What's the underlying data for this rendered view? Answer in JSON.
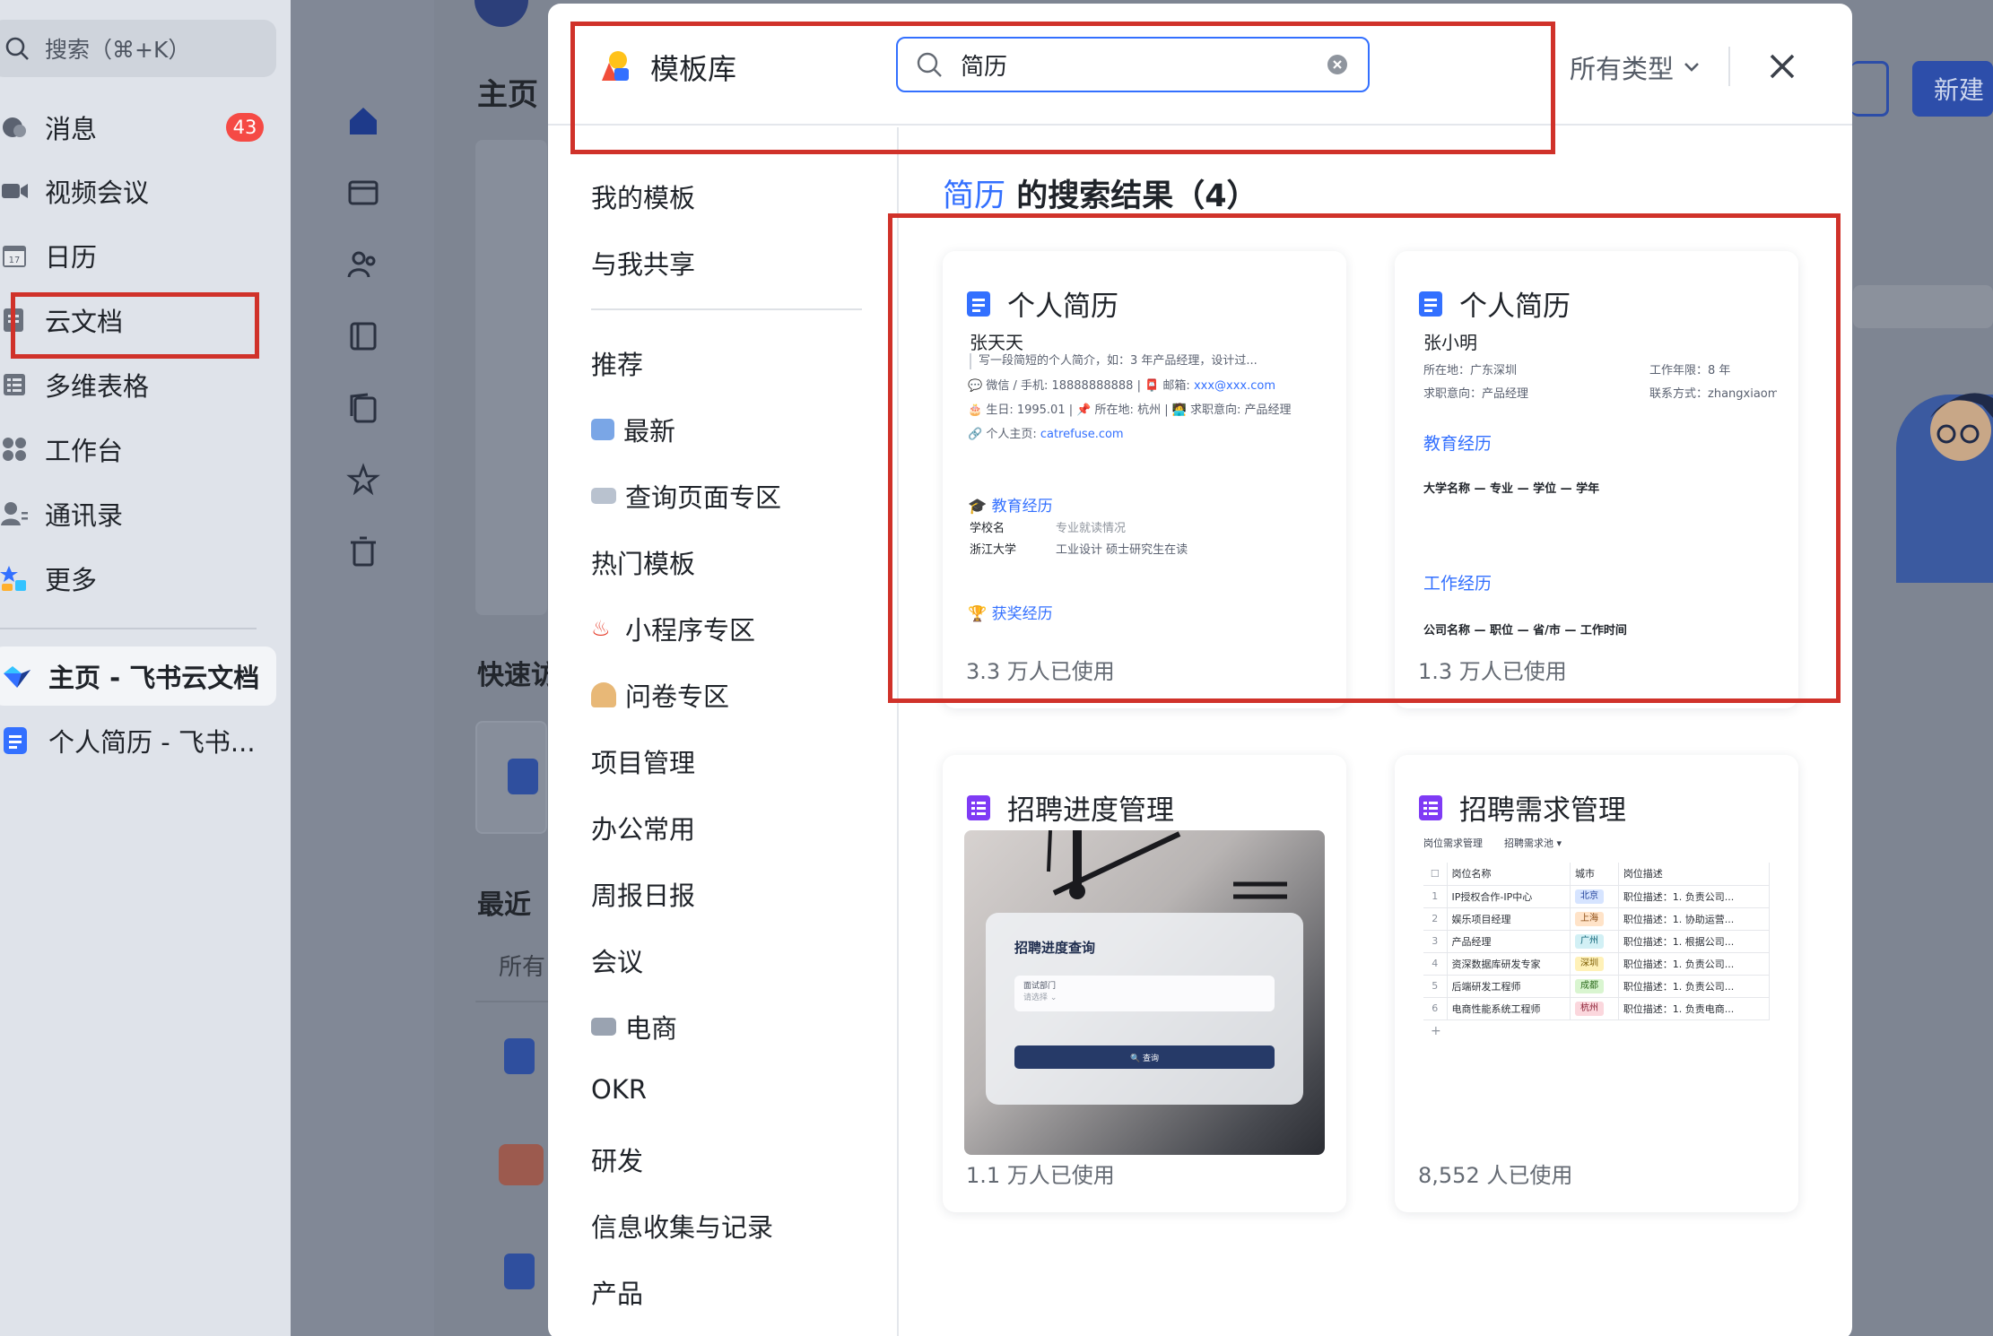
{
  "sidebar": {
    "search_placeholder": "搜索（⌘+K）",
    "nav_items": [
      {
        "label": "消息",
        "badge": "43",
        "icon": "message-icon"
      },
      {
        "label": "视频会议",
        "icon": "video-icon"
      },
      {
        "label": "日历",
        "icon": "calendar-icon"
      },
      {
        "label": "云文档",
        "icon": "doc-icon"
      },
      {
        "label": "多维表格",
        "icon": "table-icon"
      },
      {
        "label": "工作台",
        "icon": "apps-icon"
      },
      {
        "label": "通讯录",
        "icon": "contacts-icon"
      },
      {
        "label": "更多",
        "icon": "more-icon"
      }
    ],
    "recent": [
      {
        "label": "主页 - 飞书云文档"
      },
      {
        "label": "个人简历 - 飞书..."
      }
    ]
  },
  "background": {
    "home_title": "主页",
    "quick_title": "快速访",
    "recent_title": "最近",
    "all_filter": "所有",
    "new_button": "新建"
  },
  "modal": {
    "title": "模板库",
    "search_value": "简历",
    "type_filter": "所有类型",
    "categories": [
      {
        "label": "我的模板"
      },
      {
        "label": "与我共享"
      },
      {
        "label": "推荐"
      },
      {
        "label": "最新",
        "icon": "new-badge-icon"
      },
      {
        "label": "查询页面专区",
        "icon": "book-icon"
      },
      {
        "label": "热门模板"
      },
      {
        "label": "小程序专区",
        "icon": "hot-spring-icon"
      },
      {
        "label": "问卷专区",
        "icon": "person-icon"
      },
      {
        "label": "项目管理"
      },
      {
        "label": "办公常用"
      },
      {
        "label": "周报日报"
      },
      {
        "label": "会议"
      },
      {
        "label": "电商",
        "icon": "cart-icon"
      },
      {
        "label": "OKR"
      },
      {
        "label": "研发"
      },
      {
        "label": "信息收集与记录"
      },
      {
        "label": "产品"
      }
    ],
    "results": {
      "keyword": "简历",
      "suffix": "的搜索结果（4）"
    },
    "cards": [
      {
        "title": "个人简历",
        "usage": "3.3 万人已使用",
        "preview": {
          "name": "张天天",
          "intro": "写一段简短的个人简介，如：3 年产品经理，设计过...",
          "line1_a": "💬 微信 / 手机: 18888888888 | 📮 邮箱: ",
          "line1_email": "xxx@xxx.com",
          "line2": "🎂 生日: 1995.01 | 📌 所在地: 杭州 | 🧑‍💻 求职意向: 产品经理",
          "line3_a": "🔗 个人主页: ",
          "line3_url": "catrefuse.com",
          "edu_title": "🎓 教育经历",
          "edu_row1": [
            "学校名",
            "专业就读情况"
          ],
          "edu_row2": [
            "浙江大学",
            "工业设计 硕士研究生在读"
          ],
          "award_title": "🏆 获奖经历"
        }
      },
      {
        "title": "个人简历",
        "usage": "1.3 万人已使用",
        "preview": {
          "name": "张小明",
          "loc": "所在地：广东深圳",
          "years": "工作年限：8 年",
          "intent": "求职意向：产品经理",
          "contact": "联系方式：zhangxiaom",
          "edu_title": "教育经历",
          "edu_line": "大学名称 — 专业 — 学位 — 学年",
          "work_title": "工作经历",
          "work_line": "公司名称 — 职位 — 省/市 — 工作时间"
        }
      },
      {
        "title": "招聘进度管理",
        "usage": "1.1 万人已使用",
        "preview": {
          "panel_title": "招聘进度查询",
          "field_label": "面试部门",
          "field_placeholder": "请选择 ⌄",
          "button": "🔍 查询"
        }
      },
      {
        "title": "招聘需求管理",
        "usage": "8,552 人已使用",
        "preview": {
          "tab1": "岗位需求管理",
          "tab2": "招聘需求池 ▾",
          "headers": [
            "",
            "岗位名称",
            "城市",
            "岗位描述"
          ],
          "rows": [
            {
              "n": "1",
              "name": "IP授权合作-IP中心",
              "city": "北京",
              "desc": "职位描述：1. 负责公司..."
            },
            {
              "n": "2",
              "name": "娱乐项目经理",
              "city": "上海",
              "desc": "职位描述：1. 协助运营..."
            },
            {
              "n": "3",
              "name": "产品经理",
              "city": "广州",
              "desc": "职位描述：1. 根据公司..."
            },
            {
              "n": "4",
              "name": "资深数据库研发专家",
              "city": "深圳",
              "desc": "职位描述：1. 负责公司..."
            },
            {
              "n": "5",
              "name": "后端研发工程师",
              "city": "成都",
              "desc": "职位描述：1. 负责公司..."
            },
            {
              "n": "6",
              "name": "电商性能系统工程师",
              "city": "杭州",
              "desc": "职位描述：1. 负责电商..."
            }
          ]
        }
      }
    ]
  },
  "colors": {
    "accent": "#3370ff",
    "highlight_box": "#d0322a",
    "badge": "#f54a45"
  }
}
